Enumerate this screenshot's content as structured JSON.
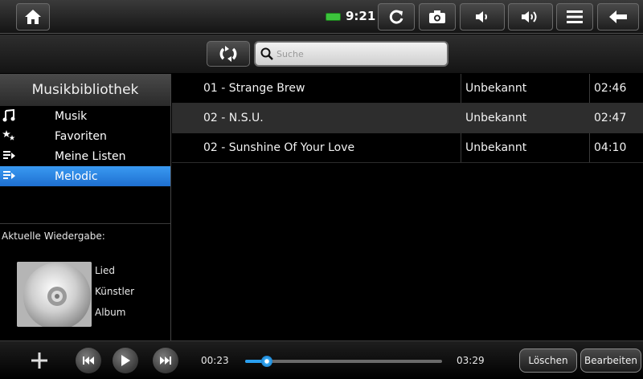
{
  "statusbar": {
    "clock": "9:21",
    "icons": [
      "home-icon",
      "battery-icon",
      "refresh-icon",
      "camera-icon",
      "volume-down-icon",
      "volume-up-icon",
      "menu-icon",
      "back-icon"
    ]
  },
  "toolbar": {
    "search_placeholder": "Suche",
    "sync_icon": "sync-icon"
  },
  "sidebar": {
    "title": "Musikbibliothek",
    "items": [
      {
        "label": "Musik",
        "icon": "music-note-icon",
        "selected": false
      },
      {
        "label": "Favoriten",
        "icon": "stars-icon",
        "selected": false
      },
      {
        "label": "Meine Listen",
        "icon": "playlist-icon",
        "selected": false
      },
      {
        "label": "Melodic",
        "icon": "playlist-icon",
        "selected": true
      }
    ],
    "now_playing_label": "Aktuelle Wiedergabe:",
    "now_playing": {
      "song": "Lied",
      "artist": "Künstler",
      "album": "Album"
    }
  },
  "tracks": [
    {
      "title": "01 - Strange Brew",
      "artist": "Unbekannt",
      "duration": "02:46"
    },
    {
      "title": "02 - N.S.U.",
      "artist": "Unbekannt",
      "duration": "02:47"
    },
    {
      "title": "02 - Sunshine Of Your Love",
      "artist": "Unbekannt",
      "duration": "04:10"
    }
  ],
  "player": {
    "elapsed": "00:23",
    "total": "03:29",
    "progress_fraction": 0.11,
    "delete_label": "Löschen",
    "edit_label": "Bearbeiten"
  },
  "colors": {
    "accent": "#2aa0f0",
    "selected_item": "#1e6fd0",
    "battery": "#3cc33c"
  }
}
